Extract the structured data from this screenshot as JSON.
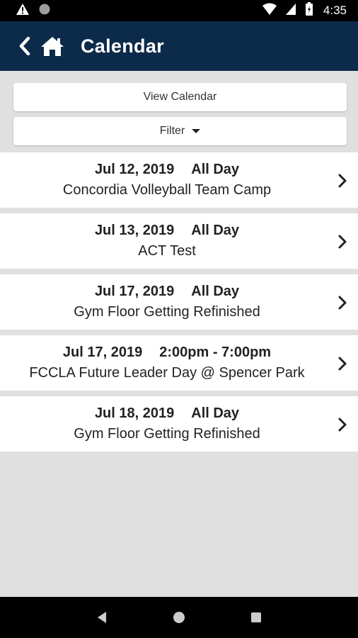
{
  "status_bar": {
    "time": "4:35",
    "left_icons": [
      "warning-icon",
      "circle-icon"
    ],
    "right_icons": [
      "wifi-icon",
      "signal-icon",
      "battery-icon"
    ]
  },
  "app_bar": {
    "title": "Calendar",
    "background": "#0c2a4a"
  },
  "controls": {
    "view_calendar_label": "View Calendar",
    "filter_label": "Filter"
  },
  "events": [
    {
      "date": "Jul 12, 2019",
      "time": "All Day",
      "title": "Concordia Volleyball Team Camp"
    },
    {
      "date": "Jul 13, 2019",
      "time": "All Day",
      "title": "ACT Test"
    },
    {
      "date": "Jul 17, 2019",
      "time": "All Day",
      "title": "Gym Floor Getting Refinished"
    },
    {
      "date": "Jul 17, 2019",
      "time": "2:00pm - 7:00pm",
      "title": "FCCLA Future Leader Day @ Spencer Park"
    },
    {
      "date": "Jul 18, 2019",
      "time": "All Day",
      "title": "Gym Floor Getting Refinished"
    }
  ],
  "nav_bar": {
    "buttons": [
      "back-triangle-icon",
      "home-circle-icon",
      "recents-square-icon"
    ]
  }
}
